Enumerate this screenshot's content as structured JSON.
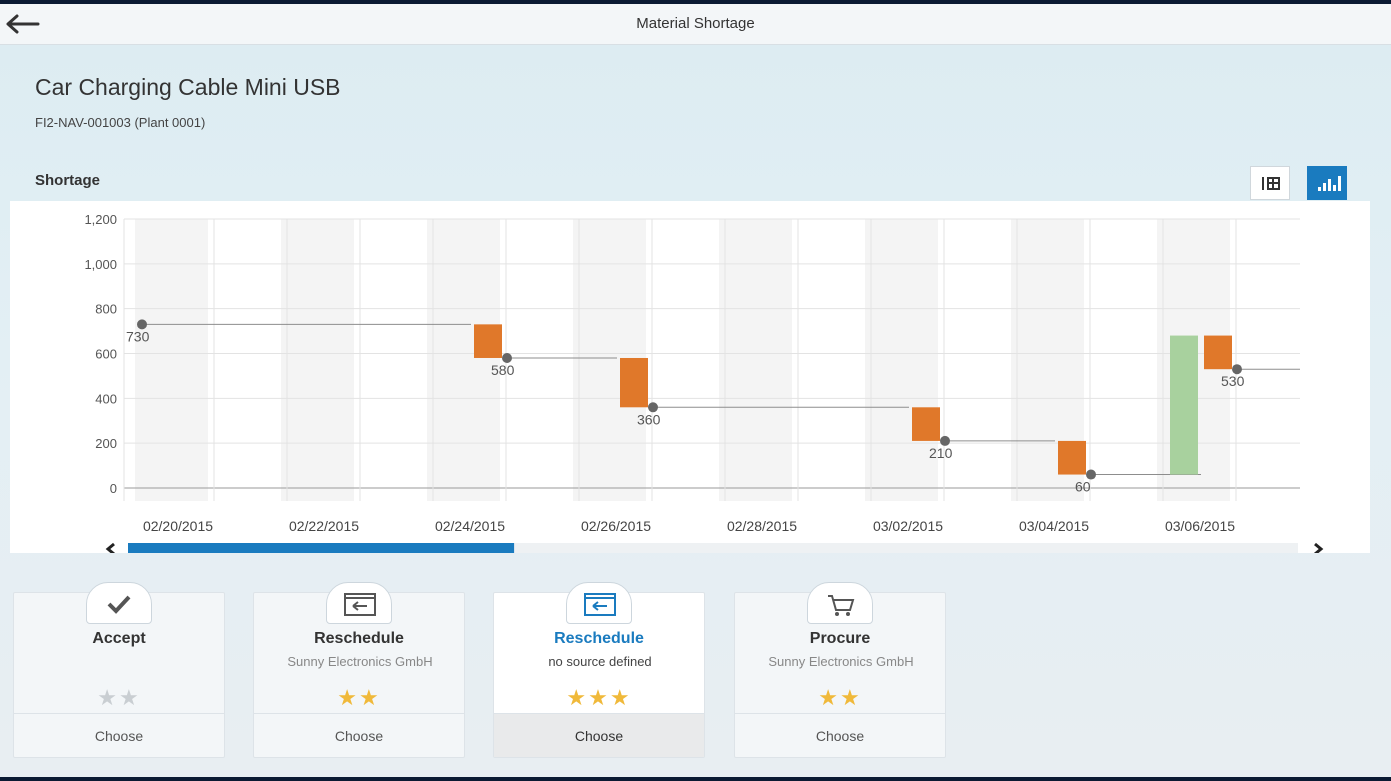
{
  "header": {
    "title": "Material Shortage"
  },
  "product": {
    "name": "Car Charging Cable Mini USB",
    "id": "FI2-NAV-001003 (Plant 0001)"
  },
  "section": {
    "label": "Shortage"
  },
  "colors": {
    "accent": "#1a7bbf",
    "shortage_bar": "#e0782a",
    "replenish_bar": "#a8d19e",
    "star": "#f0b93a",
    "star_off": "#c9ced2"
  },
  "chart_data": {
    "type": "bar",
    "subtype": "waterfall",
    "ylim": [
      0,
      1200
    ],
    "y_ticks": [
      "1,200",
      "1,000",
      "800",
      "600",
      "400",
      "200",
      "0"
    ],
    "x_tick_labels": [
      "02/20/2015",
      "02/22/2015",
      "02/24/2015",
      "02/26/2015",
      "02/28/2015",
      "03/02/2015",
      "03/04/2015",
      "03/06/2015"
    ],
    "points": [
      {
        "x": "02/20/2015",
        "value": 730,
        "label": "730"
      },
      {
        "x": "02/25/2015",
        "value": 580,
        "label": "580"
      },
      {
        "x": "02/27/2015",
        "value": 360,
        "label": "360"
      },
      {
        "x": "03/03/2015",
        "value": 210,
        "label": "210"
      },
      {
        "x": "03/05/2015",
        "value": 60,
        "label": "60"
      },
      {
        "x": "03/07/2015",
        "value": 530,
        "label": "530"
      }
    ],
    "bars": [
      {
        "x": "02/24/2015",
        "from": 730,
        "to": 580,
        "kind": "shortage"
      },
      {
        "x": "02/26/2015",
        "from": 580,
        "to": 360,
        "kind": "shortage"
      },
      {
        "x": "03/02/2015",
        "from": 360,
        "to": 210,
        "kind": "shortage"
      },
      {
        "x": "03/04/2015",
        "from": 210,
        "to": 60,
        "kind": "shortage"
      },
      {
        "x": "03/06/2015",
        "from": 60,
        "to": 680,
        "kind": "receipt"
      },
      {
        "x": "03/06/2015",
        "from": 680,
        "to": 530,
        "kind": "shortage"
      }
    ],
    "grid": true,
    "legend": "none",
    "scroll_fraction": 0.33
  },
  "solutions": [
    {
      "title": "Accept",
      "desc": "",
      "stars": 2,
      "max_stars": 3,
      "choose": "Choose",
      "icon": "checkmark-icon",
      "selected": false,
      "rated": false
    },
    {
      "title": "Reschedule",
      "desc": "Sunny Electronics GmbH",
      "stars": 2,
      "max_stars": 3,
      "choose": "Choose",
      "icon": "calendar-reschedule-icon",
      "selected": false,
      "rated": true
    },
    {
      "title": "Reschedule",
      "desc": "no source defined",
      "stars": 3,
      "max_stars": 3,
      "choose": "Choose",
      "icon": "calendar-reschedule-icon",
      "selected": true,
      "rated": true
    },
    {
      "title": "Procure",
      "desc": "Sunny Electronics GmbH",
      "stars": 2,
      "max_stars": 3,
      "choose": "Choose",
      "icon": "cart-icon",
      "selected": false,
      "rated": true
    }
  ]
}
